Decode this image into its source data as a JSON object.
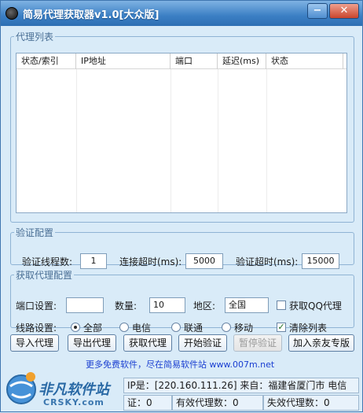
{
  "window": {
    "title": "简易代理获取器v1.0[大众版]",
    "minimize_label": "−",
    "close_label": "✕"
  },
  "proxy_list": {
    "title": "代理列表",
    "columns": [
      "状态/索引",
      "IP地址",
      "端口",
      "延迟(ms)",
      "状态"
    ]
  },
  "verify_config": {
    "title": "验证配置",
    "threads_label": "验证线程数:",
    "threads_value": "1",
    "connect_timeout_label": "连接超时(ms):",
    "connect_timeout_value": "5000",
    "verify_timeout_label": "验证超时(ms):",
    "verify_timeout_value": "15000"
  },
  "fetch_config": {
    "title": "获取代理配置",
    "port_label": "端口设置:",
    "port_value": "",
    "count_label": "数量:",
    "count_value": "10",
    "region_label": "地区:",
    "region_value": "全国",
    "qq_proxy_label": "获取QQ代理",
    "qq_proxy_checked": false,
    "line_label": "线路设置:",
    "line_options": [
      "全部",
      "电信",
      "联通",
      "移动"
    ],
    "line_selected": "全部",
    "clear_list_label": "清除列表",
    "clear_list_checked": true
  },
  "buttons": {
    "import": "导入代理",
    "export": "导出代理",
    "fetch": "获取代理",
    "start_verify": "开始验证",
    "pause_verify": "暂停验证",
    "pro_version": "加入亲友专版"
  },
  "promo": "更多免费软件，尽在简易软件站 www.007m.net",
  "status": {
    "ip_info": "IP是：[220.160.111.26] 来自：福建省厦门市 电信",
    "verifying": "证：0",
    "valid_count": "有效代理数：0",
    "invalid_count": "失效代理数：0"
  },
  "watermark": {
    "text": "非凡软件站",
    "sub": "CRSKY.com",
    "color": "#1b5e9e"
  }
}
